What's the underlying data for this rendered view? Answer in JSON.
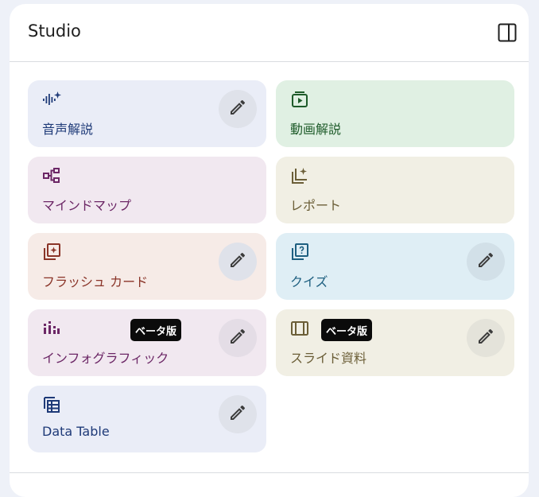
{
  "header": {
    "title": "Studio",
    "toggle_icon": "side-panel-icon"
  },
  "colors": {
    "blue_bg": "#eaedf7",
    "blue_fg": "#1e3a78",
    "green_bg": "#e0f0e3",
    "green_fg": "#1e5b2a",
    "purple_bg": "#f1e8f0",
    "purple_fg": "#6c2766",
    "olive_bg": "#f1efe4",
    "olive_fg": "#6b5e37",
    "red_bg": "#f6ebe7",
    "red_fg": "#8a3428",
    "cyan_bg": "#dfeef5",
    "cyan_fg": "#1e5f80",
    "edit_bg": "#dfe2ea"
  },
  "cards": [
    {
      "label": "音声解説",
      "icon": "audio-sparkle-icon",
      "editable": true
    },
    {
      "label": "動画解説",
      "icon": "video-play-icon",
      "editable": false
    },
    {
      "label": "マインドマップ",
      "icon": "mind-map-icon",
      "editable": false
    },
    {
      "label": "レポート",
      "icon": "report-sparkle-icon",
      "editable": false
    },
    {
      "label": "フラッシュ カード",
      "icon": "flashcard-icon",
      "editable": true
    },
    {
      "label": "クイズ",
      "icon": "quiz-icon",
      "editable": true
    },
    {
      "label": "インフォグラフィック",
      "icon": "infographic-icon",
      "editable": true,
      "badge": "ベータ版"
    },
    {
      "label": "スライド資料",
      "icon": "slides-icon",
      "editable": true,
      "badge": "ベータ版"
    },
    {
      "label": "Data Table",
      "icon": "data-table-icon",
      "editable": true
    }
  ]
}
